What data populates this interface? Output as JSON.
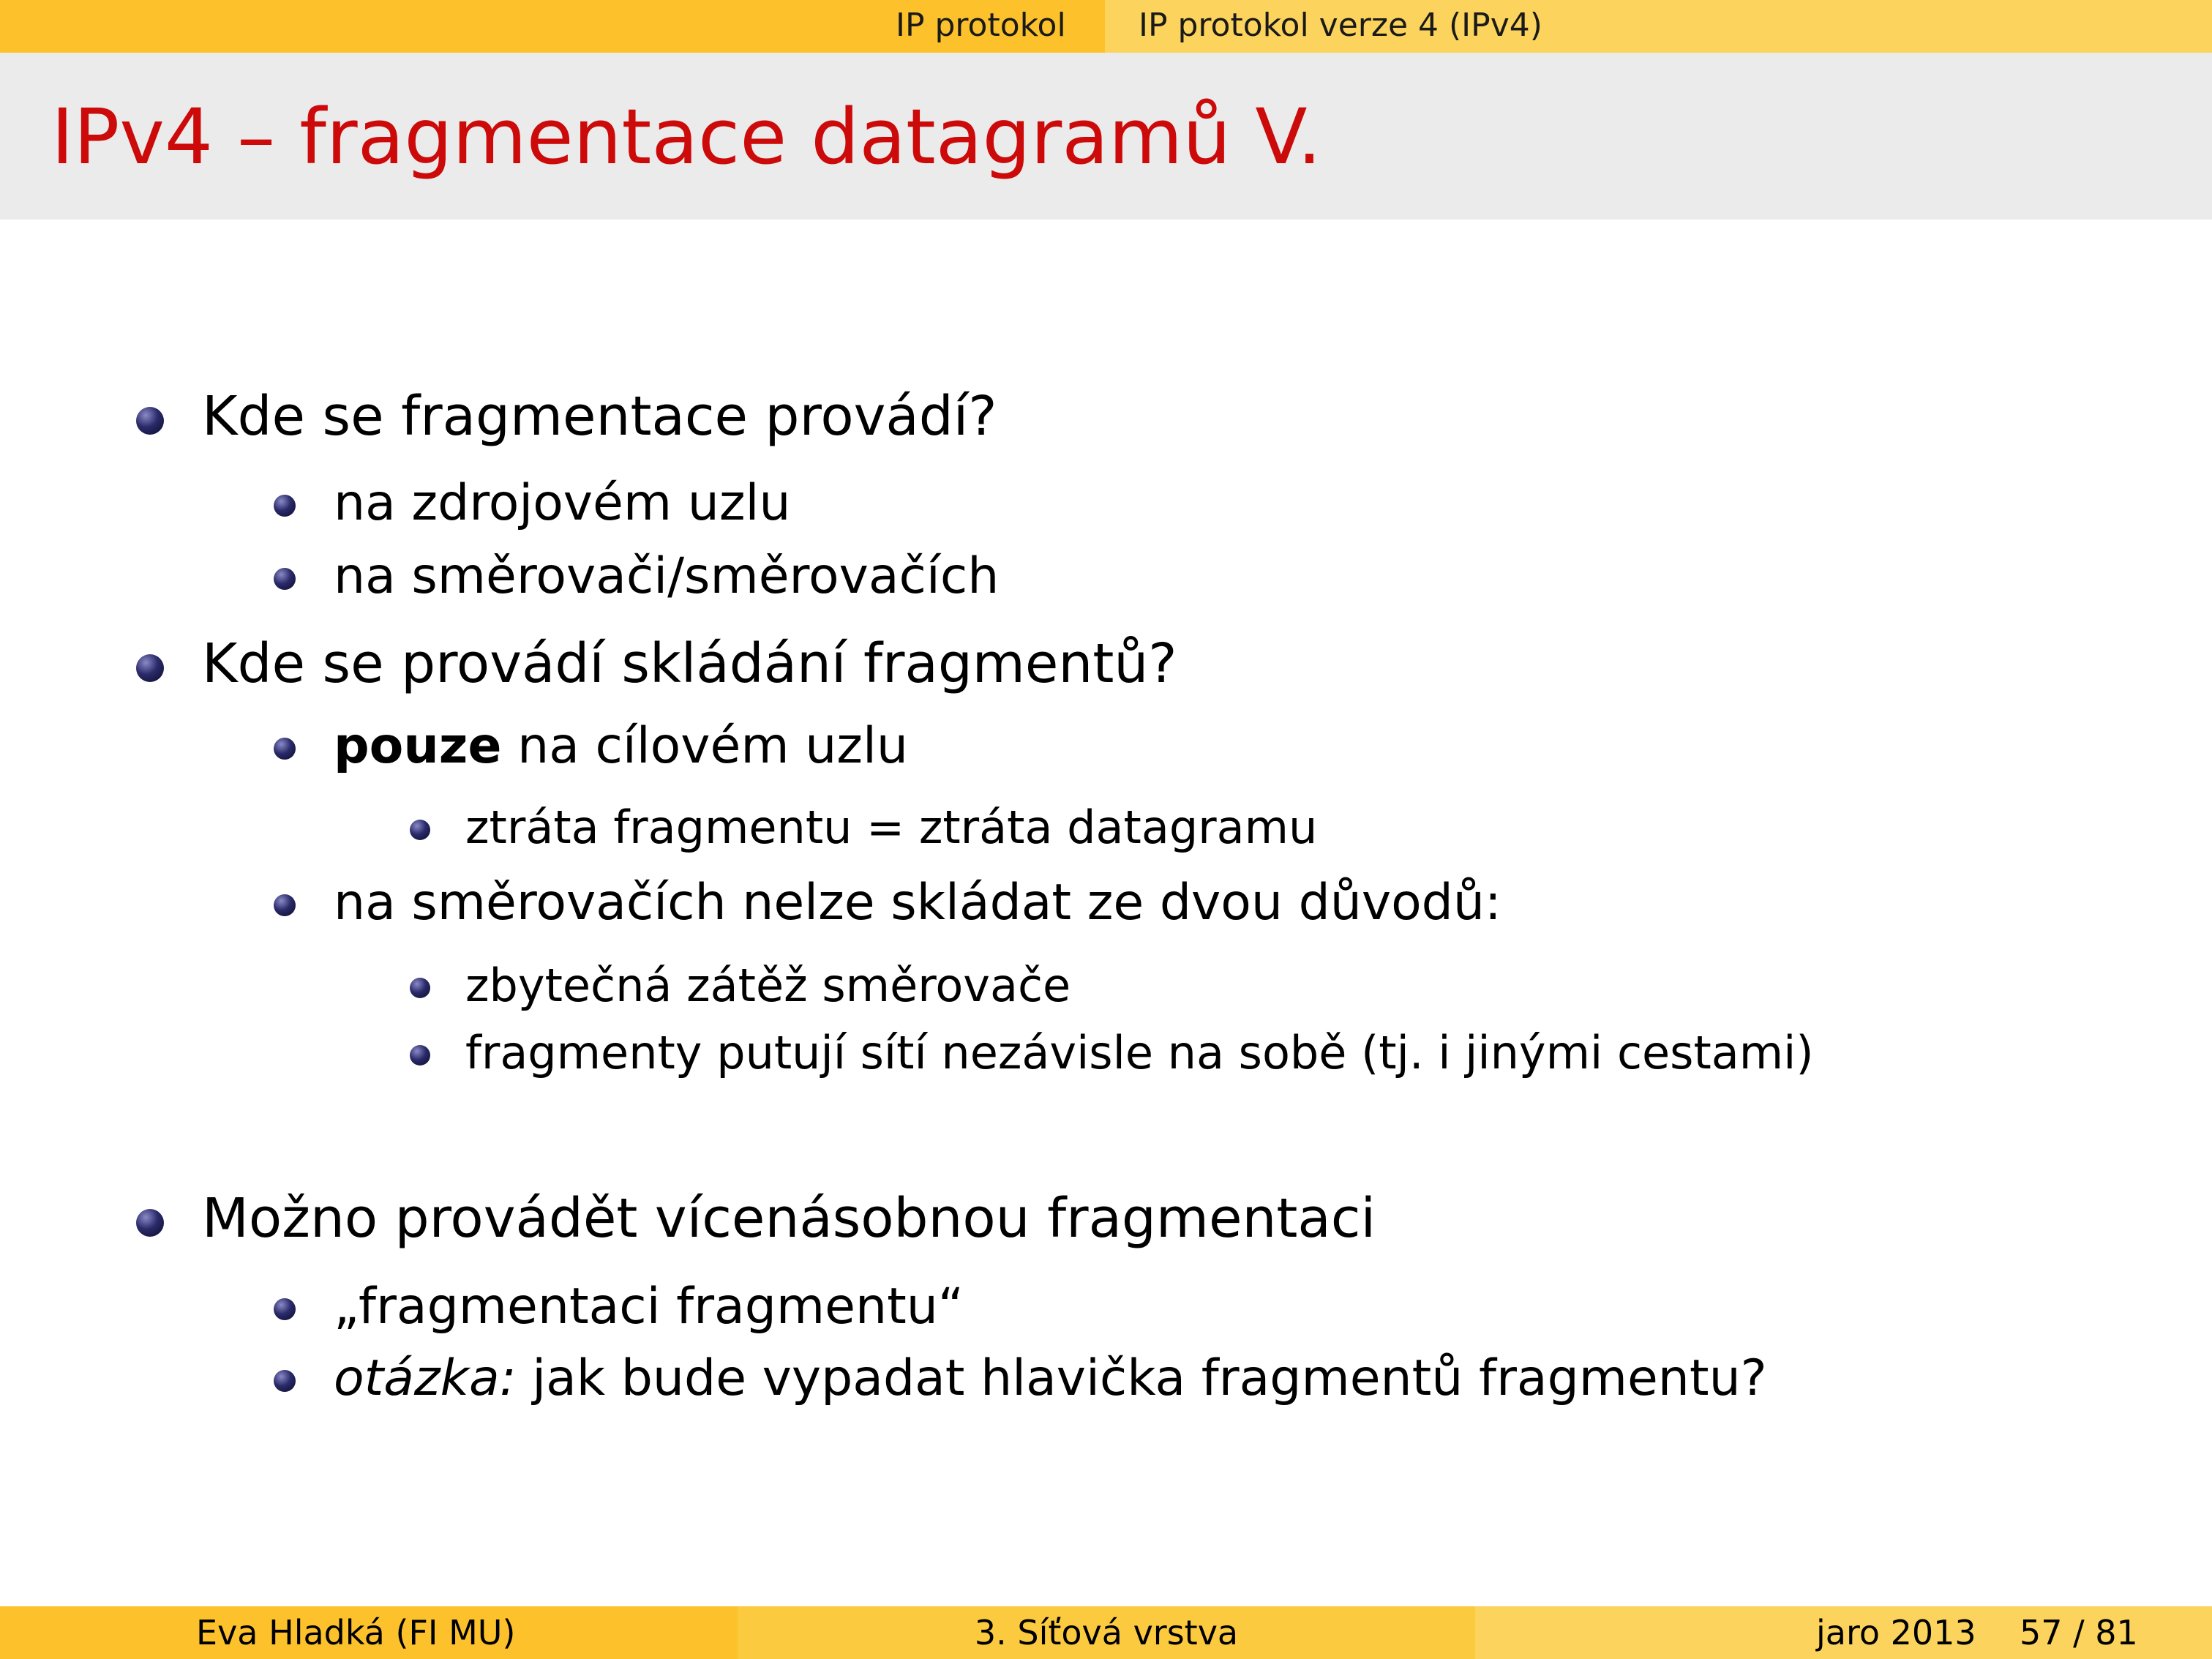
{
  "header": {
    "section": "IP protokol",
    "subsection": "IP protokol verze 4 (IPv4)"
  },
  "slide_title": "IPv4 – fragmentace datagramů V.",
  "content": {
    "q1": "Kde se fragmentace provádí?",
    "q1_a": "na zdrojovém uzlu",
    "q1_b": "na směrovači/směrovačích",
    "q2": "Kde se provádí skládání fragmentů?",
    "q2_a_bold": "pouze",
    "q2_a_rest": " na cílovém uzlu",
    "q2_a_sub": "ztráta fragmentu = ztráta datagramu",
    "q2_b": "na směrovačích nelze skládat ze dvou důvodů:",
    "q2_b_sub1": "zbytečná zátěž směrovače",
    "q2_b_sub2": "fragmenty putují sítí nezávisle na sobě (tj. i jinými cestami)",
    "q3": "Možno provádět vícenásobnou fragmentaci",
    "q3_a": "„fragmentaci fragmentu“",
    "q3_b_italic": "otázka:",
    "q3_b_rest": " jak bude vypadat hlavička fragmentů fragmentu?"
  },
  "footer": {
    "author": "Eva Hladká  (FI MU)",
    "title": "3. Síťová vrstva",
    "date": "jaro 2013",
    "page": "57 / 81"
  },
  "colors": {
    "bar": "#fcc12b",
    "title": "#cc0a0a",
    "title_band": "#ebebeb",
    "bullet": "#2a2a6a"
  }
}
